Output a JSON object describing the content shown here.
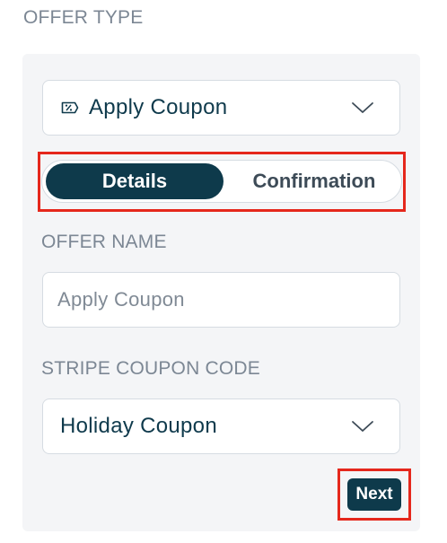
{
  "offer_type": {
    "title": "OFFER TYPE",
    "selected": "Apply Coupon",
    "icon": "coupon-tag-icon"
  },
  "tabs": [
    {
      "label": "Details",
      "active": true
    },
    {
      "label": "Confirmation",
      "active": false
    }
  ],
  "offer_name": {
    "label": "OFFER NAME",
    "value": "",
    "placeholder": "Apply Coupon"
  },
  "stripe_coupon": {
    "label": "STRIPE COUPON CODE",
    "selected": "Holiday Coupon"
  },
  "actions": {
    "next_label": "Next"
  },
  "colors": {
    "primary": "#0e3a4b",
    "highlight": "#e5271c",
    "panel_bg": "#f4f5f7",
    "label_text": "#7c8794"
  }
}
